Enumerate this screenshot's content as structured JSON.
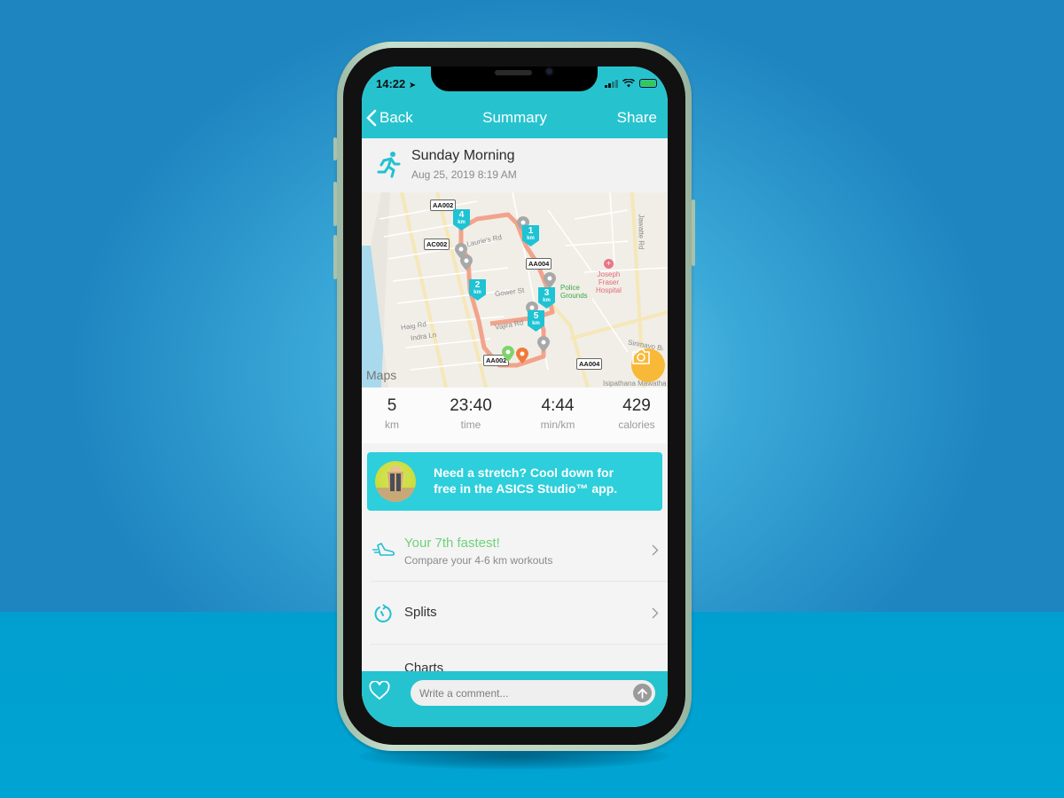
{
  "status_bar": {
    "time": "14:22"
  },
  "nav": {
    "back_label": "Back",
    "title": "Summary",
    "share_label": "Share"
  },
  "activity": {
    "title": "Sunday Morning",
    "date": "Aug 25, 2019 8:19 AM"
  },
  "map": {
    "attribution": "Maps",
    "road_tags": [
      "AA002",
      "AC002",
      "AA004",
      "AA002",
      "AA004"
    ],
    "street_labels": [
      "Laurie's Rd",
      "Gower St",
      "Vajira Rd",
      "Haig Rd",
      "Indra Ln",
      "Jawatte Rd",
      "Sirimavo Bandaranaike Mawatha",
      "Isipathana Mawatha",
      "Rd"
    ],
    "poi": {
      "hospital": "Joseph\nFraser\nHospital",
      "police": "Police\nGrounds"
    },
    "km_markers": [
      {
        "n": "1",
        "u": "km"
      },
      {
        "n": "2",
        "u": "km"
      },
      {
        "n": "3",
        "u": "km"
      },
      {
        "n": "4",
        "u": "km"
      },
      {
        "n": "5",
        "u": "km"
      }
    ],
    "colors": {
      "route": "#f2957a",
      "marker": "#1ec3d4",
      "start": "#7ed36a",
      "end": "#f07a3a",
      "camera": "#f9b938"
    }
  },
  "stats": [
    {
      "value": "5",
      "label": "km"
    },
    {
      "value": "23:40",
      "label": "time"
    },
    {
      "value": "4:44",
      "label": "min/km"
    },
    {
      "value": "429",
      "label": "calories"
    }
  ],
  "promo": {
    "line1": "Need a stretch? Cool down for",
    "line2": "free in the ASICS Studio™ app."
  },
  "fastest": {
    "title": "Your 7th fastest!",
    "subtitle": "Compare your 4-6 km workouts"
  },
  "splits": {
    "title": "Splits"
  },
  "charts": {
    "title": "Charts"
  },
  "comment": {
    "placeholder": "Write a comment..."
  },
  "theme": {
    "accent": "#26c3cf",
    "highlight_green": "#6fd27a"
  }
}
